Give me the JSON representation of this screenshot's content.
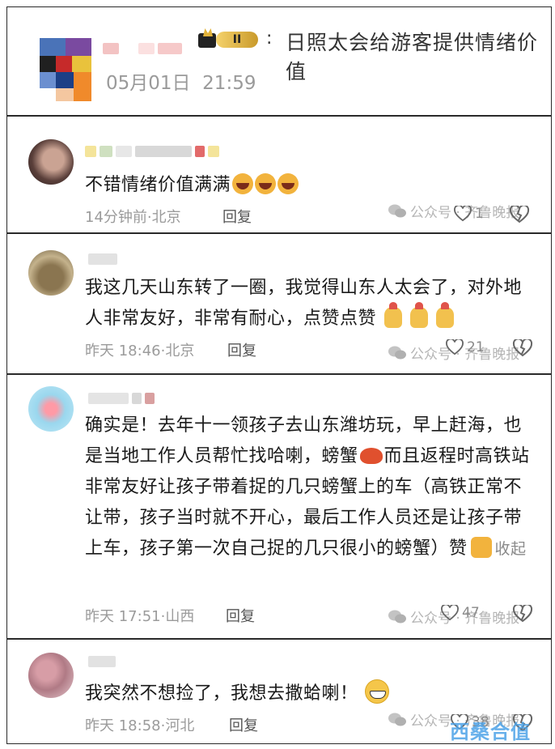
{
  "post": {
    "badge": "II",
    "colon": ":",
    "title": "日照太会给游客提供情绪价值",
    "date": "05月01日",
    "time": "21:59"
  },
  "watermark": {
    "label": "公众号 · 齐鲁晚报"
  },
  "comments": [
    {
      "text": "不错情绪价值满满",
      "emoji": "grinning-squint-face",
      "time": "14分钟前·北京",
      "reply": "回复",
      "likes": "1"
    },
    {
      "text": "我这几天山东转了一圈，我觉得山东人太会了，对外地人非常友好，非常有耐心，点赞点赞",
      "emoji": "finger-heart-hand",
      "time": "昨天 18:46·北京",
      "reply": "回复",
      "likes": "21"
    },
    {
      "text_a": "确实是！去年十一领孩子去山东潍坊玩，早上赶海，也是当地工作人员帮忙找哈喇，螃蟹",
      "text_b": "而且返程时高铁站非常友好让孩子带着捉的几只螃蟹上的车（高铁正常不让带，孩子当时就不开心，最后工作人员还是让孩子带上车，孩子第一次自己捉的几只很小的螃蟹）赞",
      "collapse": "收起",
      "time": "昨天 17:51·山西",
      "reply": "回复",
      "likes": "47"
    },
    {
      "text": "我突然不想捡了，我想去撒蛤喇！",
      "emoji": "grinning-face",
      "time": "昨天 18:58·河北",
      "reply": "回复",
      "likes": "38"
    }
  ],
  "corner_logo": {
    "text": "西桑合值"
  }
}
